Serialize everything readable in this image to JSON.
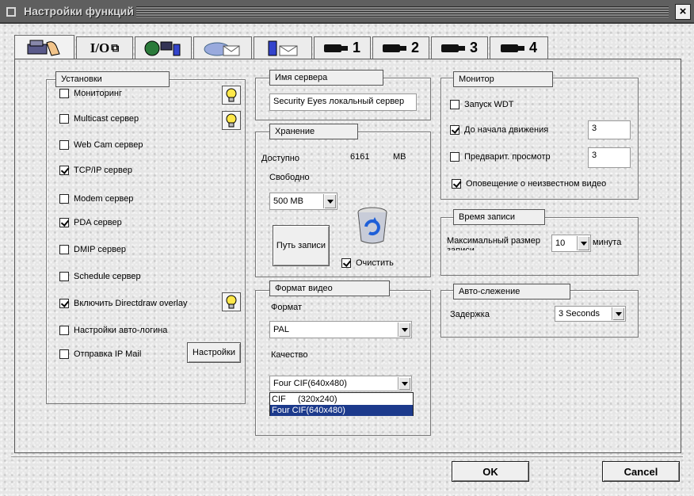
{
  "window": {
    "title": "Настройки функций",
    "close_label": "×"
  },
  "tabs": [
    {
      "icon": "settings-hand-icon"
    },
    {
      "label": "I/O"
    },
    {
      "icon": "network-icon"
    },
    {
      "icon": "email-icon"
    },
    {
      "icon": "pda-mail-icon"
    },
    {
      "label": "1",
      "icon": "camera-icon"
    },
    {
      "label": "2",
      "icon": "camera-icon"
    },
    {
      "label": "3",
      "icon": "camera-icon"
    },
    {
      "label": "4",
      "icon": "camera-icon"
    }
  ],
  "settings": {
    "title": "Установки",
    "items": [
      {
        "label": "Мониторинг",
        "checked": false
      },
      {
        "label": "Multicast сервер",
        "checked": false
      },
      {
        "label": "Web Cam сервер",
        "checked": false
      },
      {
        "label": "TCP/IP сервер",
        "checked": true
      },
      {
        "label": "Modem сервер",
        "checked": false
      },
      {
        "label": "PDA сервер",
        "checked": true
      },
      {
        "label": "DMIP сервер",
        "checked": false
      },
      {
        "label": "Schedule сервер",
        "checked": false
      },
      {
        "label": "Включить Directdraw overlay",
        "checked": true
      },
      {
        "label": "Настройки авто-логина",
        "checked": false
      },
      {
        "label": "Отправка IP Mail",
        "checked": false
      }
    ],
    "settings_button": "Настройки"
  },
  "server_name": {
    "title": "Имя сервера",
    "value": "Security Eyes локальный сервер"
  },
  "storage": {
    "title": "Хранение",
    "available_label": "Доступно",
    "available_value": "6161",
    "available_unit": "MB",
    "free_label": "Свободно",
    "free_select": "500 MB",
    "record_path_button": "Путь записи",
    "clean_label": "Очистить",
    "clean_checked": true
  },
  "video_format": {
    "title": "Формат видео",
    "format_label": "Формат",
    "format_value": "PAL",
    "quality_label": "Качество",
    "quality_value": "Four CIF(640x480)",
    "quality_options": [
      "CIF     (320x240)",
      "Four CIF(640x480)"
    ]
  },
  "monitor": {
    "title": "Монитор",
    "wdt_label": "Запуск WDT",
    "wdt_checked": false,
    "pre_motion_label": "До начала движения",
    "pre_motion_checked": true,
    "pre_motion_value": "3",
    "preview_label": "Предварит. просмотр",
    "preview_checked": false,
    "preview_value": "3",
    "unknown_video_label": "Оповещение о неизвестном видео",
    "unknown_video_checked": true
  },
  "record_time": {
    "title": "Время записи",
    "max_size_label": "Максимальный размер",
    "max_size_label2": "записи",
    "max_size_value": "10",
    "unit": "минута"
  },
  "auto_tracking": {
    "title": "Авто-слежение",
    "delay_label": "Задержка",
    "delay_value": "3 Seconds"
  },
  "footer": {
    "ok_label": "OK",
    "cancel_label": "Cancel"
  }
}
